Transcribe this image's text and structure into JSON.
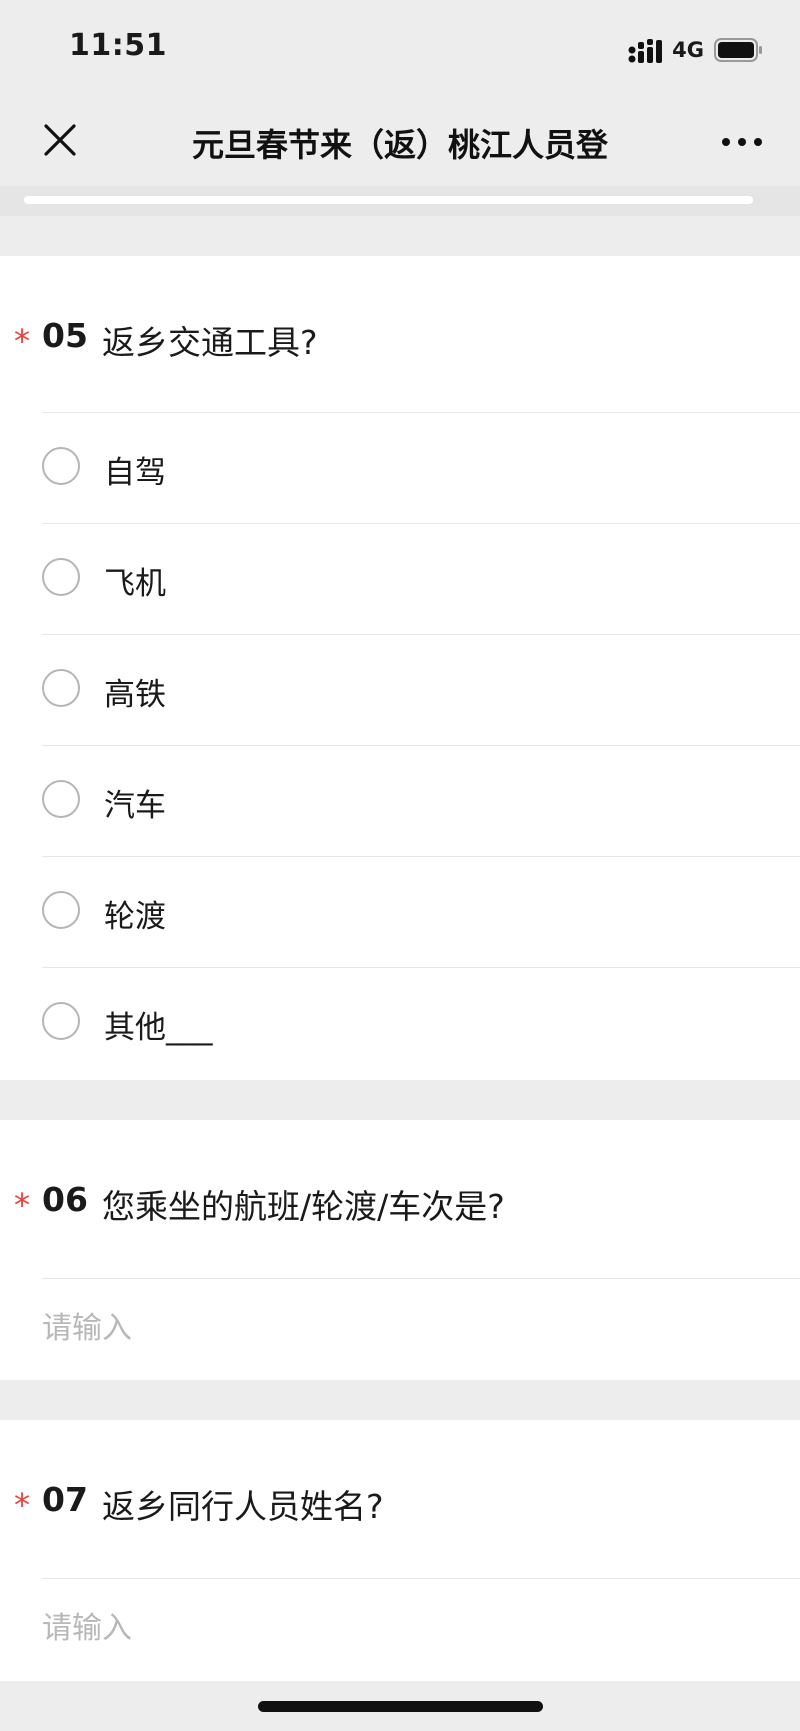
{
  "status_bar": {
    "time": "11:51",
    "network": "4G",
    "signal_icon": "signal-bars-icon",
    "battery_icon": "battery-icon"
  },
  "nav": {
    "title": "元旦春节来（返）桃江人员登",
    "close_icon": "close-icon",
    "more_icon": "more-icon"
  },
  "progress": {
    "fraction": 0.97
  },
  "colors": {
    "required": "#e64340",
    "background": "#ededed",
    "placeholder": "#b8b8b8"
  },
  "questions": [
    {
      "required_mark": "*",
      "number": "05",
      "text": "返乡交通工具?",
      "type": "single-choice",
      "options": [
        {
          "label": "自驾"
        },
        {
          "label": "飞机"
        },
        {
          "label": "高铁"
        },
        {
          "label": "汽车"
        },
        {
          "label": "轮渡"
        },
        {
          "label": "其他___"
        }
      ]
    },
    {
      "required_mark": "*",
      "number": "06",
      "text": "您乘坐的航班/轮渡/车次是?",
      "type": "text",
      "placeholder": "请输入"
    },
    {
      "required_mark": "*",
      "number": "07",
      "text": "返乡同行人员姓名?",
      "type": "text",
      "placeholder": "请输入"
    }
  ]
}
